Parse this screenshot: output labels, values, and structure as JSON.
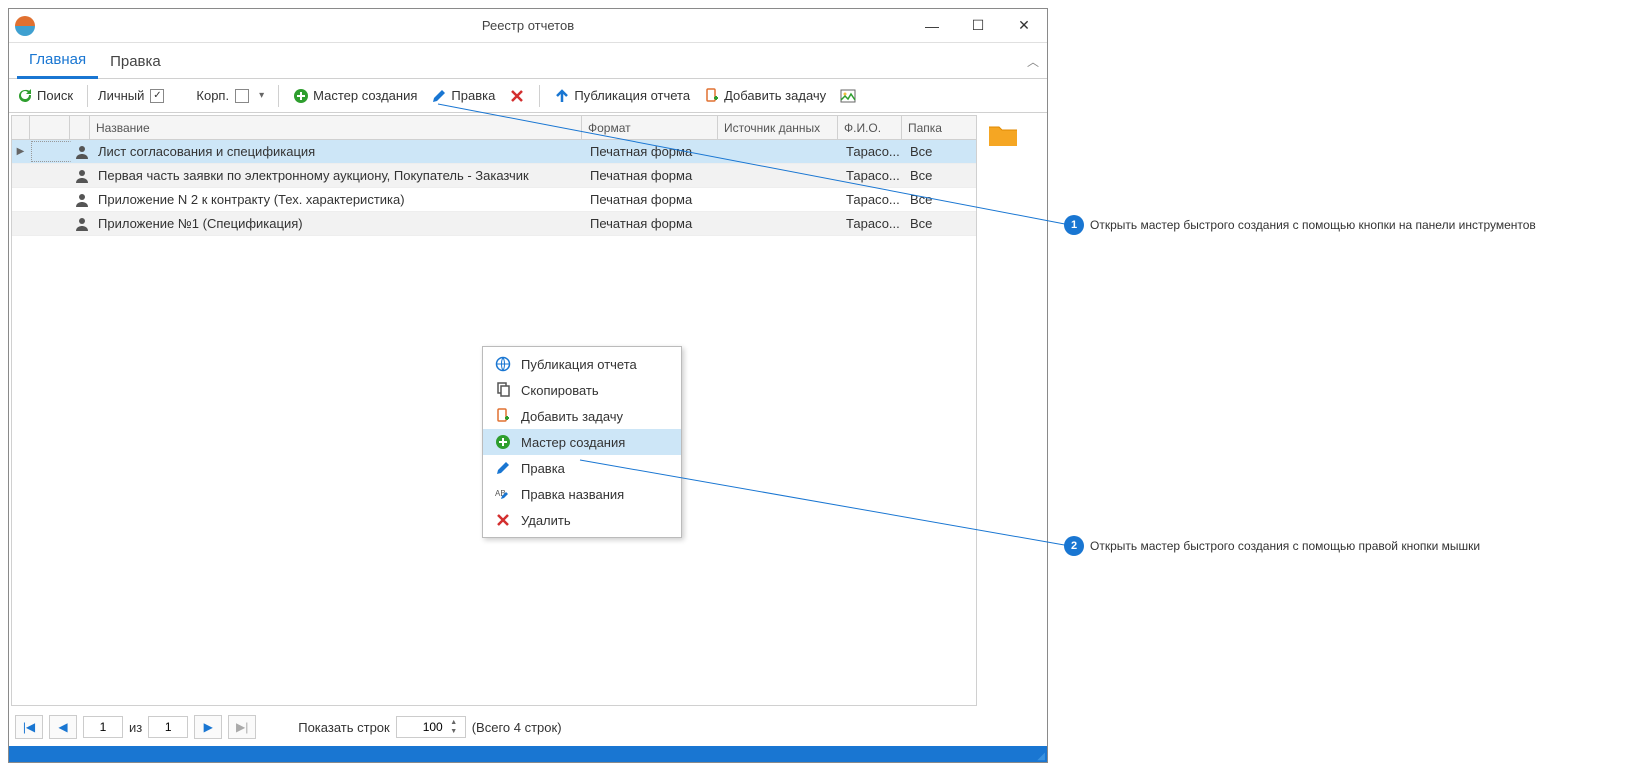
{
  "window": {
    "title": "Реестр отчетов"
  },
  "tabs": {
    "main": "Главная",
    "edit": "Правка"
  },
  "toolbar": {
    "search": "Поиск",
    "personal": "Личный",
    "corp": "Корп.",
    "master": "Мастер создания",
    "edit": "Правка",
    "publish": "Публикация отчета",
    "add_task": "Добавить задачу"
  },
  "columns": {
    "name": "Название",
    "format": "Формат",
    "source": "Источник данных",
    "fio": "Ф.И.О.",
    "folder": "Папка"
  },
  "rows": [
    {
      "name": "Лист согласования и спецификация",
      "format": "Печатная форма",
      "source": "",
      "fio": "Тарасо...",
      "folder": "Все"
    },
    {
      "name": "Первая часть заявки по электронному аукциону, Покупатель - Заказчик",
      "format": "Печатная форма",
      "source": "",
      "fio": "Тарасо...",
      "folder": "Все"
    },
    {
      "name": "Приложение N 2 к контракту (Тех. характеристика)",
      "format": "Печатная форма",
      "source": "",
      "fio": "Тарасо...",
      "folder": "Все"
    },
    {
      "name": "Приложение №1 (Спецификация)",
      "format": "Печатная форма",
      "source": "",
      "fio": "Тарасо...",
      "folder": "Все"
    }
  ],
  "context_menu": {
    "publish": "Публикация отчета",
    "copy": "Скопировать",
    "add_task": "Добавить задачу",
    "master": "Мастер создания",
    "edit": "Правка",
    "rename": "Правка названия",
    "delete": "Удалить"
  },
  "pager": {
    "page": "1",
    "of_label": "из",
    "total_pages": "1",
    "rows_label": "Показать строк",
    "rows_value": "100",
    "total_rows": "(Всего 4 строк)"
  },
  "callouts": {
    "c1": {
      "num": "1",
      "text": "Открыть мастер быстрого создания с помощью кнопки на панели инструментов"
    },
    "c2": {
      "num": "2",
      "text": "Открыть мастер быстрого создания с помощью правой кнопки мышки"
    }
  }
}
